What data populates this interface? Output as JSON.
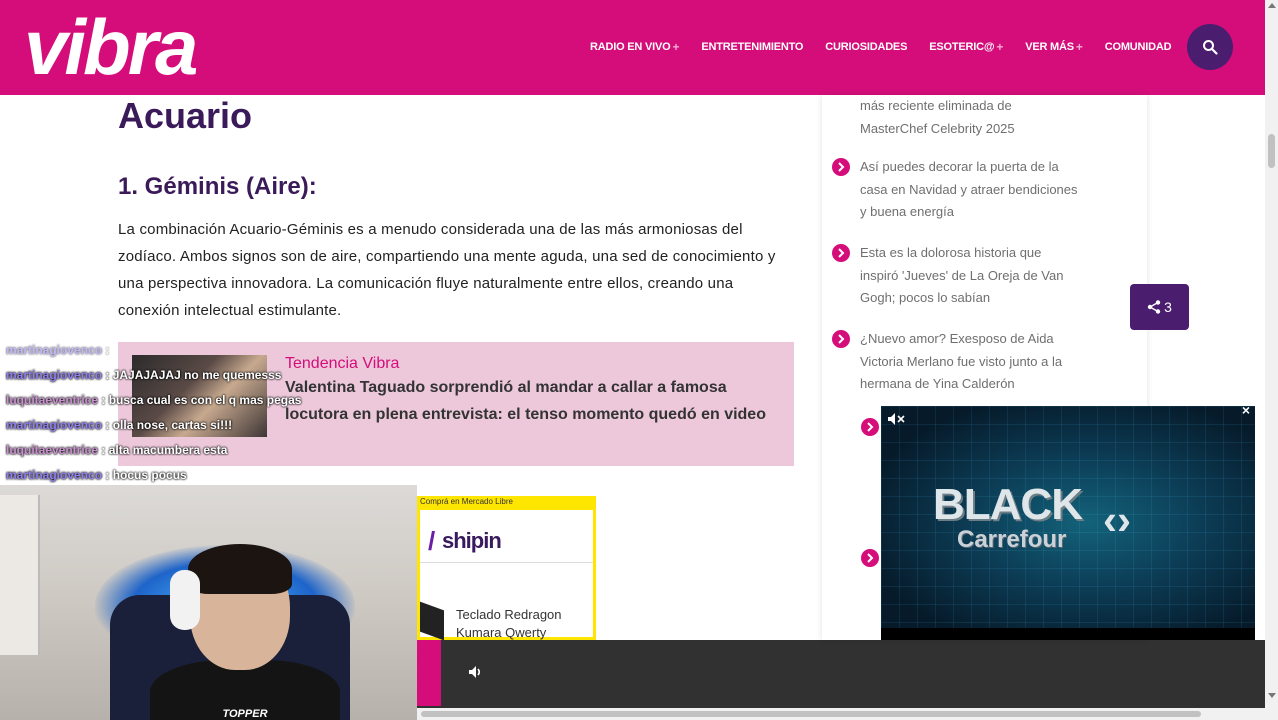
{
  "header": {
    "logo": "vibra",
    "nav": [
      {
        "label": "RADIO EN VIVO",
        "plus": "+"
      },
      {
        "label": "ENTRETENIMIENTO",
        "plus": ""
      },
      {
        "label": "CURIOSIDADES",
        "plus": ""
      },
      {
        "label": "ESOTERIC@",
        "plus": "+"
      },
      {
        "label": "VER MÁS",
        "plus": "+"
      },
      {
        "label": "COMUNIDAD",
        "plus": ""
      }
    ]
  },
  "article": {
    "heading": "Acuario",
    "subheading": "1. Géminis (Aire):",
    "paragraph": "La combinación Acuario-Géminis es a menudo considerada una de las más armoniosas del zodíaco. Ambos signos son de aire, compartiendo una mente aguda, una sed de conocimiento y una perspectiva innovadora. La comunicación fluye naturalmente entre ellos, creando una conexión intelectual estimulante."
  },
  "trend": {
    "label": "Tendencia Vibra",
    "title": "Valentina Taguado sorprendió al mandar a callar a famosa locutora en plena entrevista: el tenso momento quedó en video"
  },
  "chat": [
    {
      "user": "martinagiovenco",
      "msg": "JAJAJAJAJ no me quemesss",
      "style": "a"
    },
    {
      "user": "luquitaeventrice",
      "msg": "busca cual es con el q mas pegas",
      "style": "b"
    },
    {
      "user": "martinagiovenco",
      "msg": "olla nose, cartas si!!!",
      "style": "a"
    },
    {
      "user": "luquitaeventrice",
      "msg": "alta macumbera esta",
      "style": "b"
    },
    {
      "user": "martinagiovenco",
      "msg": "hocus pocus",
      "style": "a"
    }
  ],
  "webcam": {
    "shirt_text": "TOPPER"
  },
  "ad_card": {
    "top_label": "Comprá en Mercado Libre",
    "brand": "shipin",
    "product": "Teclado Redragon Kumara Qwerty"
  },
  "sidebar": {
    "items": [
      "más reciente eliminada de MasterChef Celebrity 2025",
      "Así puedes decorar la puerta de la casa en Navidad y atraer bendiciones y buena energía",
      "Esta es la dolorosa historia que inspiró 'Jueves' de La Oreja de Van Gogh; pocos lo sabían",
      "¿Nuevo amor? Exesposo de Aida Victoria Merlano fue visto junto a la hermana de Yina Calderón"
    ]
  },
  "share": {
    "count": "3"
  },
  "video_ad": {
    "line1": "BLACK",
    "line2": "Carrefour",
    "close": "×"
  },
  "colors": {
    "brand": "#d50d7a",
    "purple": "#4a1d6e",
    "heading": "#3b1a5a"
  }
}
